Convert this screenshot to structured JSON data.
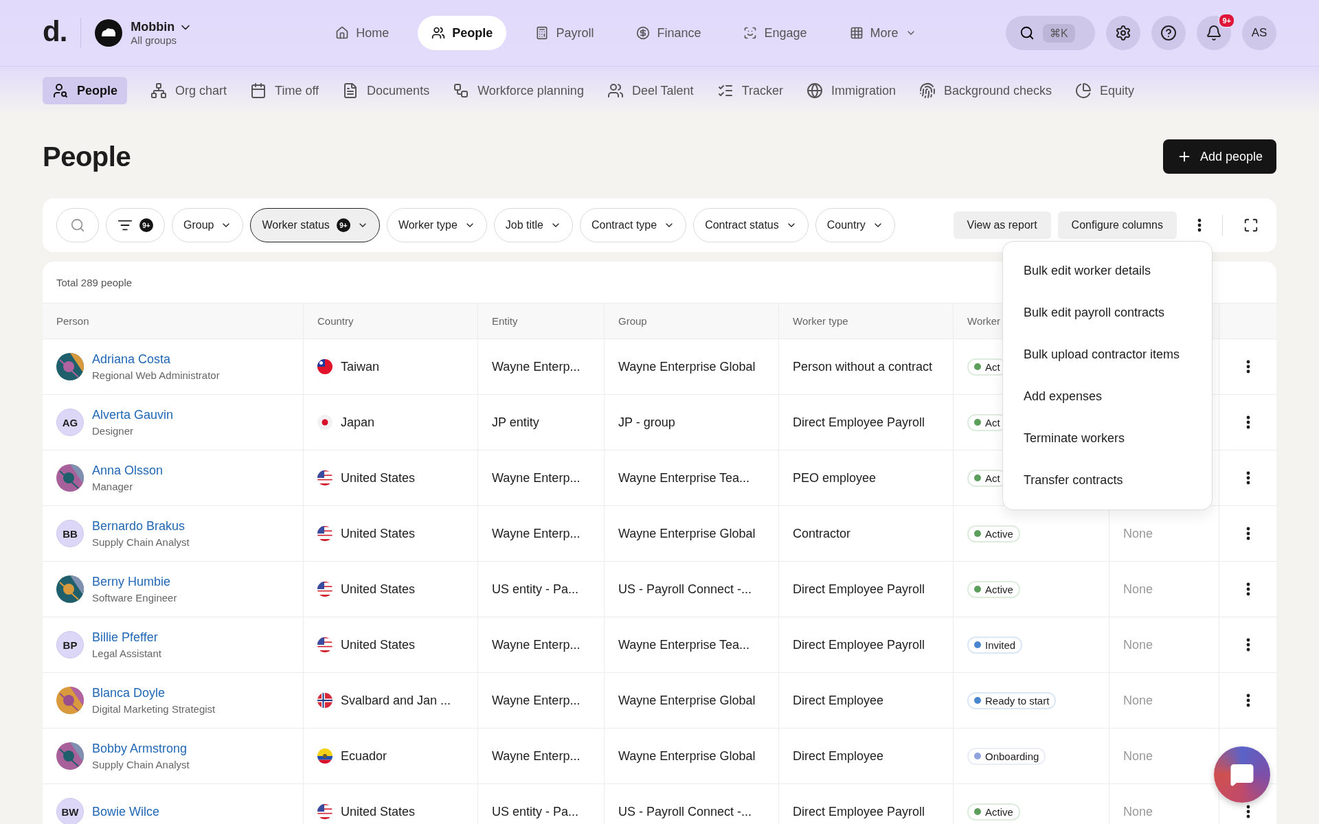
{
  "header": {
    "logo": "d.",
    "org": {
      "name": "Mobbin",
      "subtitle": "All groups"
    },
    "nav": [
      {
        "label": "Home",
        "selected": false
      },
      {
        "label": "People",
        "selected": true
      },
      {
        "label": "Payroll",
        "selected": false
      },
      {
        "label": "Finance",
        "selected": false
      },
      {
        "label": "Engage",
        "selected": false
      },
      {
        "label": "More",
        "selected": false
      }
    ],
    "search_shortcut": "⌘K",
    "notifications_badge": "9+",
    "user_initials": "AS"
  },
  "subnav": [
    {
      "label": "People",
      "selected": true
    },
    {
      "label": "Org chart",
      "selected": false
    },
    {
      "label": "Time off",
      "selected": false
    },
    {
      "label": "Documents",
      "selected": false
    },
    {
      "label": "Workforce planning",
      "selected": false
    },
    {
      "label": "Deel Talent",
      "selected": false
    },
    {
      "label": "Tracker",
      "selected": false
    },
    {
      "label": "Immigration",
      "selected": false
    },
    {
      "label": "Background checks",
      "selected": false
    },
    {
      "label": "Equity",
      "selected": false
    }
  ],
  "page": {
    "title": "People",
    "primary_button": "Add people"
  },
  "filters": {
    "filter_badge": "9+",
    "chips": [
      {
        "label": "Group",
        "active": false
      },
      {
        "label": "Worker status",
        "active": true,
        "badge": "9+"
      },
      {
        "label": "Worker type",
        "active": false
      },
      {
        "label": "Job title",
        "active": false
      },
      {
        "label": "Contract type",
        "active": false
      },
      {
        "label": "Contract status",
        "active": false
      },
      {
        "label": "Country",
        "active": false
      }
    ],
    "buttons": [
      "View as report",
      "Configure columns"
    ]
  },
  "table": {
    "total": "Total 289 people",
    "columns": [
      "Person",
      "Country",
      "Entity",
      "Group",
      "Worker type",
      "Worker"
    ],
    "rows": [
      {
        "menu_button": true,
        "name": "Adriana Costa",
        "title": "Regional Web Administrator",
        "country": {
          "name": "Taiwan",
          "kind": "tw"
        },
        "entity": "Wayne Enterp...",
        "group": "Wayne Enterprise Global",
        "worker_type": "Person without a contract",
        "status": {
          "label": "Act",
          "color": "#5c9e5c"
        }
      },
      {
        "avatar": {
          "kind": "initials",
          "initials": "AG"
        },
        "menu_button": true,
        "name": "Alverta Gauvin",
        "title": "Designer",
        "country": {
          "name": "Japan",
          "kind": "jp"
        },
        "entity": "JP entity",
        "group": "JP - group",
        "worker_type": "Direct Employee Payroll",
        "status": {
          "label": "Act",
          "color": "#5c9e5c"
        }
      },
      {
        "menu_button": true,
        "name": "Anna Olsson",
        "title": "Manager",
        "country": {
          "name": "United States",
          "kind": "us"
        },
        "entity": "Wayne Enterp...",
        "group": "Wayne Enterprise Tea...",
        "worker_type": "PEO employee",
        "status": {
          "label": "Act",
          "color": "#5c9e5c"
        }
      },
      {
        "avatar": {
          "kind": "initials",
          "initials": "BB"
        },
        "menu_button": true,
        "name": "Bernardo Brakus",
        "title": "Supply Chain Analyst",
        "country": {
          "name": "United States",
          "kind": "us"
        },
        "entity": "Wayne Enterp...",
        "group": "Wayne Enterprise Global",
        "worker_type": "Contractor",
        "status": {
          "label": "Active",
          "color": "#5c9e5c"
        },
        "column_7": "None"
      },
      {
        "menu_button": true,
        "name": "Berny Humbie",
        "title": "Software Engineer",
        "country": {
          "name": "United States",
          "kind": "us"
        },
        "entity": "US entity - Pa...",
        "group": "US - Payroll Connect -...",
        "worker_type": "Direct Employee Payroll",
        "status": {
          "label": "Active",
          "color": "#5c9e5c"
        },
        "column_7": "None"
      },
      {
        "avatar": {
          "kind": "initials",
          "initials": "BP"
        },
        "menu_button": true,
        "name": "Billie Pfeffer",
        "title": "Legal Assistant",
        "country": {
          "name": "United States",
          "kind": "us"
        },
        "entity": "Wayne Enterp...",
        "group": "Wayne Enterprise Tea...",
        "worker_type": "Direct Employee Payroll",
        "status": {
          "label": "Invited",
          "color": "#4a86d0"
        },
        "column_7": "None"
      },
      {
        "menu_button": true,
        "name": "Blanca Doyle",
        "title": "Digital Marketing Strategist",
        "country": {
          "name": "Svalbard and Jan ...",
          "kind": "no"
        },
        "entity": "Wayne Enterp...",
        "group": "Wayne Enterprise Global",
        "worker_type": "Direct Employee",
        "status": {
          "label": "Ready to start",
          "color": "#4a86d0"
        },
        "column_7": "None"
      },
      {
        "name": "Bobby Armstrong",
        "title": "Supply Chain Analyst",
        "country": {
          "name": "Ecuador",
          "kind": "ec"
        },
        "entity": "Wayne Enterp...",
        "group": "Wayne Enterprise Global",
        "worker_type": "Direct Employee",
        "status": {
          "label": "Onboarding",
          "color": "#8fa3dd"
        },
        "column_7": "None"
      },
      {
        "avatar": {
          "kind": "initials",
          "initials": "BW"
        },
        "menu_button": true,
        "name": "Bowie Wilce",
        "country": {
          "name": "United States",
          "kind": "us"
        },
        "entity": "US entity - Pa...",
        "group": "US - Payroll Connect -...",
        "worker_type": "Direct Employee Payroll",
        "status": {
          "label": "Active",
          "color": "#5c9e5c"
        },
        "column_7": "None"
      }
    ]
  },
  "actions_menu": {
    "items": [
      "Bulk edit worker details",
      "Bulk edit payroll contracts",
      "Bulk upload contractor items",
      "Add expenses",
      "Terminate workers",
      "Transfer contracts"
    ]
  }
}
